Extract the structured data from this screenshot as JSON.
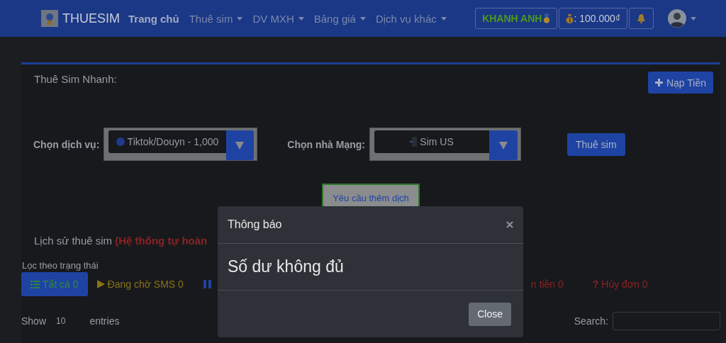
{
  "navbar": {
    "brand": "THUESIM",
    "items": [
      {
        "label": "Trang chủ",
        "selected": true,
        "dropdown": false
      },
      {
        "label": "Thuê sim",
        "selected": false,
        "dropdown": true
      },
      {
        "label": "DV MXH",
        "selected": false,
        "dropdown": true
      },
      {
        "label": "Bảng giá",
        "selected": false,
        "dropdown": true
      },
      {
        "label": "Dịch vụ khác",
        "selected": false,
        "dropdown": true
      }
    ],
    "user_button": "KHANH ANH",
    "balance": ": 100.000₫"
  },
  "quick_rent": {
    "title": "Thuê Sim Nhanh:",
    "topup_button": "Nạp Tiền",
    "service_label": "Chọn dịch vụ:",
    "service_value": "Tiktok/Douyn - 1,000",
    "carrier_label": "Chọn nhà Mạng:",
    "carrier_value": "Sim US",
    "rent_button": "Thuê sim",
    "request_button": "Yêu cầu thêm dịch"
  },
  "history": {
    "title": "Lịch sử thuê sim **(Hệ thống tự hoàn**",
    "filter_label": "Lọc theo trạng thái",
    "filters": [
      {
        "kind": "all",
        "label": "Tất cả 0",
        "selected": true,
        "color": "#2f8a3c"
      },
      {
        "kind": "waiting",
        "label": "Đang chờ SMS 0",
        "selected": false,
        "color": "#8a7414"
      },
      {
        "kind": "paused",
        "selected": false,
        "color": "#1f43a0"
      },
      {
        "kind": "refunded",
        "label": "n tiền 0",
        "selected": false,
        "color": "#8a2323"
      },
      {
        "kind": "cancelled",
        "icon": "?",
        "label": "Hủy đơn 0",
        "selected": false,
        "color": "#8a2323"
      }
    ],
    "show_label": "Show",
    "page_size": "10",
    "entries_label": "entries",
    "search_label": "Search:"
  },
  "modal": {
    "title": "Thông báo",
    "message": "Số dư không đủ",
    "close_button": "Close"
  }
}
